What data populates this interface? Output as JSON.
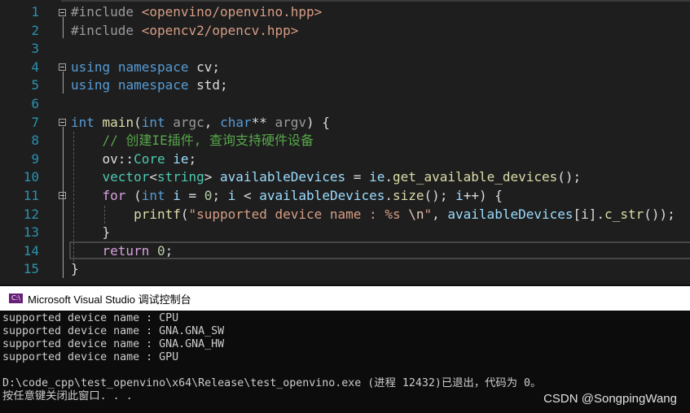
{
  "editor": {
    "line_numbers": [
      "1",
      "2",
      "3",
      "4",
      "5",
      "6",
      "7",
      "8",
      "9",
      "10",
      "11",
      "12",
      "13",
      "14",
      "15"
    ],
    "lines": [
      [
        [
          "pp",
          "#include "
        ],
        [
          "str",
          "<openvino/openvino.hpp>"
        ]
      ],
      [
        [
          "pp",
          "#include "
        ],
        [
          "str",
          "<opencv2/opencv.hpp>"
        ]
      ],
      [],
      [
        [
          "kw",
          "using"
        ],
        [
          "pl",
          " "
        ],
        [
          "kw",
          "namespace"
        ],
        [
          "pl",
          " cv;"
        ]
      ],
      [
        [
          "kw",
          "using"
        ],
        [
          "pl",
          " "
        ],
        [
          "kw",
          "namespace"
        ],
        [
          "pl",
          " std;"
        ]
      ],
      [],
      [
        [
          "kw",
          "int"
        ],
        [
          "pl",
          " "
        ],
        [
          "fn",
          "main"
        ],
        [
          "pl",
          "("
        ],
        [
          "kw",
          "int"
        ],
        [
          "pl",
          " "
        ],
        [
          "param",
          "argc"
        ],
        [
          "pl",
          ", "
        ],
        [
          "kw",
          "char"
        ],
        [
          "pl",
          "** "
        ],
        [
          "param",
          "argv"
        ],
        [
          "pl",
          ") {"
        ]
      ],
      [
        [
          "pl",
          "    "
        ],
        [
          "com",
          "// 创建IE插件, 查询支持硬件设备"
        ]
      ],
      [
        [
          "pl",
          "    ov::"
        ],
        [
          "type",
          "Core"
        ],
        [
          "pl",
          " "
        ],
        [
          "var",
          "ie"
        ],
        [
          "pl",
          ";"
        ]
      ],
      [
        [
          "pl",
          "    "
        ],
        [
          "type",
          "vector"
        ],
        [
          "pl",
          "<"
        ],
        [
          "type",
          "string"
        ],
        [
          "pl",
          "> "
        ],
        [
          "var",
          "availableDevices"
        ],
        [
          "pl",
          " = "
        ],
        [
          "var",
          "ie"
        ],
        [
          "pl",
          "."
        ],
        [
          "fn",
          "get_available_devices"
        ],
        [
          "pl",
          "();"
        ]
      ],
      [
        [
          "pl",
          "    "
        ],
        [
          "ctl",
          "for"
        ],
        [
          "pl",
          " ("
        ],
        [
          "kw",
          "int"
        ],
        [
          "pl",
          " "
        ],
        [
          "var",
          "i"
        ],
        [
          "pl",
          " = "
        ],
        [
          "num",
          "0"
        ],
        [
          "pl",
          "; "
        ],
        [
          "var",
          "i"
        ],
        [
          "pl",
          " < "
        ],
        [
          "var",
          "availableDevices"
        ],
        [
          "pl",
          "."
        ],
        [
          "fn",
          "size"
        ],
        [
          "pl",
          "(); "
        ],
        [
          "var",
          "i"
        ],
        [
          "pl",
          "++) {"
        ]
      ],
      [
        [
          "pl",
          "        "
        ],
        [
          "fn",
          "printf"
        ],
        [
          "pl",
          "("
        ],
        [
          "str",
          "\"supported device name : %s "
        ],
        [
          "esc",
          "\\n"
        ],
        [
          "str",
          "\""
        ],
        [
          "pl",
          ", "
        ],
        [
          "var",
          "availableDevices"
        ],
        [
          "pl",
          "[i]."
        ],
        [
          "fn",
          "c_str"
        ],
        [
          "pl",
          "());"
        ]
      ],
      [
        [
          "pl",
          "    }"
        ]
      ],
      [
        [
          "pl",
          "    "
        ],
        [
          "ctl",
          "return"
        ],
        [
          "pl",
          " "
        ],
        [
          "num",
          "0"
        ],
        [
          "pl",
          ";"
        ]
      ],
      [
        [
          "pl",
          "}"
        ]
      ]
    ]
  },
  "console": {
    "icon_label": "C:\\",
    "title": "Microsoft Visual Studio 调试控制台",
    "output": [
      "supported device name : CPU",
      "supported device name : GNA.GNA_SW",
      "supported device name : GNA.GNA_HW",
      "supported device name : GPU",
      "",
      "D:\\code_cpp\\test_openvino\\x64\\Release\\test_openvino.exe (进程 12432)已退出，代码为 0。",
      "按任意键关闭此窗口. . ."
    ]
  },
  "watermark": "CSDN @SongpingWang"
}
